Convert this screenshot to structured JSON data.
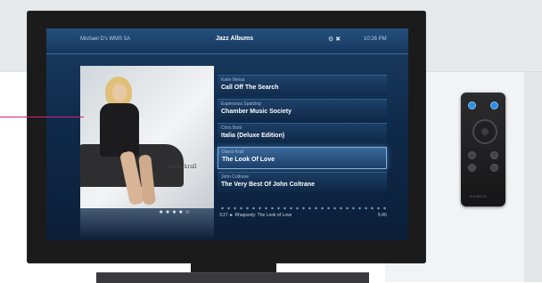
{
  "header": {
    "device_name": "Michael D's WMS 5A",
    "title": "Jazz Albums",
    "icons": "⚙ ✖",
    "time": "10:26 PM"
  },
  "album_art": {
    "artist_logo": "diana krall"
  },
  "list": {
    "items": [
      {
        "artist": "Katie Melua",
        "album": "Call Off The Search",
        "selected": false
      },
      {
        "artist": "Esperanza Spalding",
        "album": "Chamber Music Society",
        "selected": false
      },
      {
        "artist": "Chris Botti",
        "album": "Italia (Deluxe Edition)",
        "selected": false
      },
      {
        "artist": "Diana Krall",
        "album": "The Look Of Love",
        "selected": true
      },
      {
        "artist": "John Coltrane",
        "album": "The Very Best Of John Coltrane",
        "selected": false
      }
    ]
  },
  "rating": "★★★★☆",
  "now_playing": {
    "elapsed_and_track": "3:27 ► Rhapsody: The Look of Love",
    "duration": "5:40"
  },
  "remote": {
    "brand": "SONOS"
  },
  "colors": {
    "accent_callout": "#d61f7a",
    "screen_bg": "#0f2a4a",
    "remote_button": "#2e8de0"
  }
}
